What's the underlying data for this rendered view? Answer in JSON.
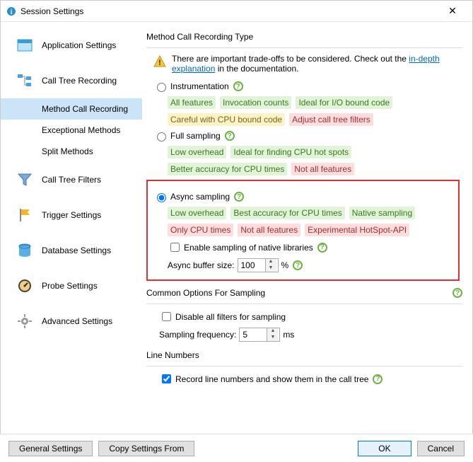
{
  "titlebar": {
    "title": "Session Settings"
  },
  "sidebar": {
    "items": [
      {
        "label": "Application Settings"
      },
      {
        "label": "Call Tree Recording"
      },
      {
        "label": "Method Call Recording"
      },
      {
        "label": "Exceptional Methods"
      },
      {
        "label": "Split Methods"
      },
      {
        "label": "Call Tree Filters"
      },
      {
        "label": "Trigger Settings"
      },
      {
        "label": "Database Settings"
      },
      {
        "label": "Probe Settings"
      },
      {
        "label": "Advanced Settings"
      }
    ]
  },
  "content": {
    "section1_title": "Method Call Recording Type",
    "warn_prefix": "There are important trade-offs to be considered. Check out the ",
    "warn_link": "in-depth explanation",
    "warn_suffix": " in the documentation.",
    "instrumentation": {
      "label": "Instrumentation",
      "tags_g": [
        "All features",
        "Invocation counts",
        "Ideal for I/O bound code"
      ],
      "tag_y": "Careful with CPU bound code",
      "tag_r": "Adjust call tree filters"
    },
    "fullsampling": {
      "label": "Full sampling",
      "tags_g": [
        "Low overhead",
        "Ideal for finding CPU hot spots",
        "Better accuracy for CPU times"
      ],
      "tag_r": "Not all features"
    },
    "async": {
      "label": "Async sampling",
      "tags_g": [
        "Low overhead",
        "Best accuracy for CPU times",
        "Native sampling"
      ],
      "tags_r": [
        "Only CPU times",
        "Not all features",
        "Experimental HotSpot-API"
      ],
      "enable_native": "Enable sampling of native libraries",
      "buffer_label": "Async buffer size:",
      "buffer_value": "100",
      "buffer_unit": "%"
    },
    "section2_title": "Common Options For Sampling",
    "disable_filters": "Disable all filters for sampling",
    "freq_label": "Sampling frequency:",
    "freq_value": "5",
    "freq_unit": "ms",
    "section3_title": "Line Numbers",
    "record_lines": "Record line numbers and show them in the call tree"
  },
  "footer": {
    "general": "General Settings",
    "copy": "Copy Settings From",
    "ok": "OK",
    "cancel": "Cancel"
  }
}
